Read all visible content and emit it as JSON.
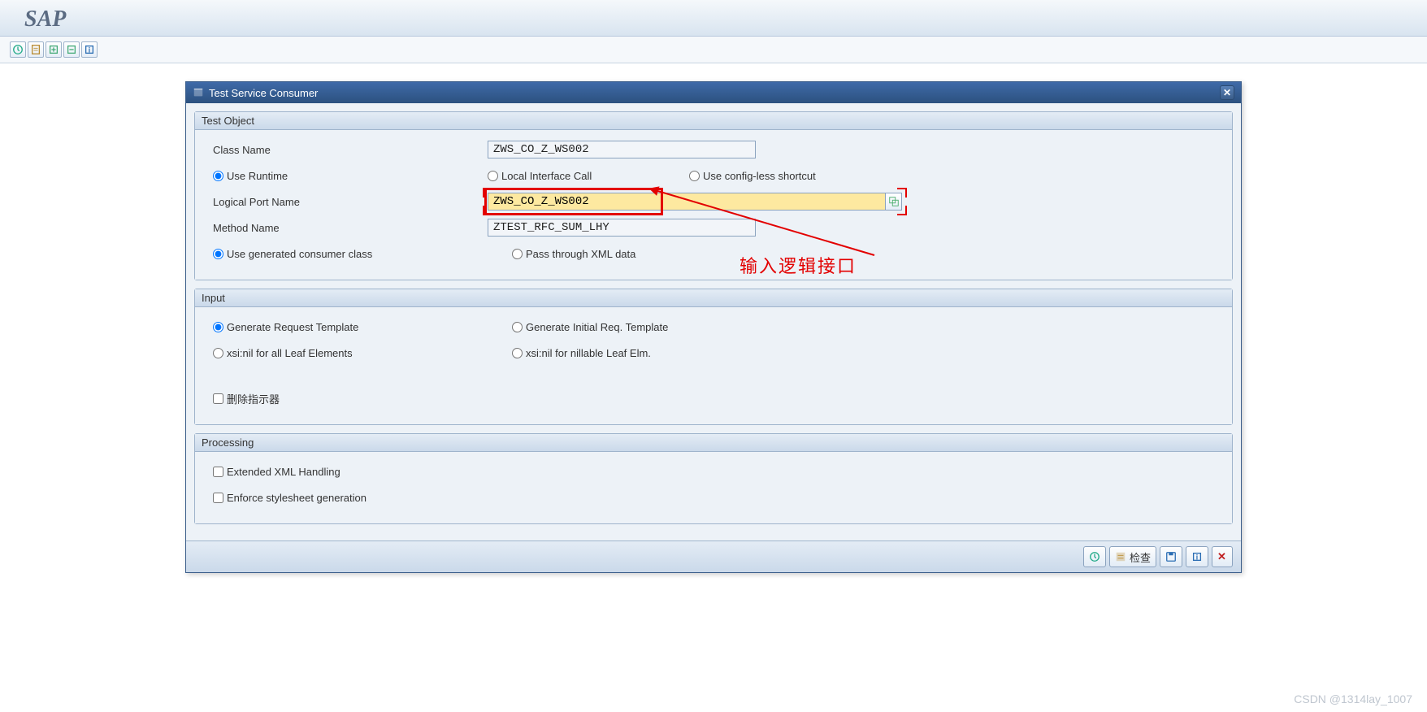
{
  "app": {
    "title": "SAP"
  },
  "dialog": {
    "title": "Test Service Consumer"
  },
  "groups": {
    "test_object": {
      "title": "Test Object",
      "class_name_label": "Class Name",
      "class_name_value": "ZWS_CO_Z_WS002",
      "radio_runtime": "Use Runtime",
      "radio_local": "Local Interface Call",
      "radio_configless": "Use config-less shortcut",
      "logical_port_label": "Logical Port Name",
      "logical_port_value": "ZWS_CO_Z_WS002",
      "method_name_label": "Method Name",
      "method_name_value": "ZTEST_RFC_SUM_LHY",
      "radio_gen_class": "Use generated consumer class",
      "radio_pass_xml": "Pass through XML data"
    },
    "input": {
      "title": "Input",
      "radio_gen_req": "Generate Request Template",
      "radio_gen_init": "Generate Initial Req. Template",
      "radio_xsi_all": "xsi:nil for all Leaf Elements",
      "radio_xsi_nillable": "xsi:nil for nillable Leaf Elm.",
      "check_delete": "删除指示器"
    },
    "processing": {
      "title": "Processing",
      "check_ext_xml": "Extended XML Handling",
      "check_enforce": "Enforce stylesheet generation"
    }
  },
  "footer": {
    "check_label": "检查"
  },
  "annotation": {
    "text": "输入逻辑接口"
  },
  "watermark": "CSDN @1314lay_1007"
}
